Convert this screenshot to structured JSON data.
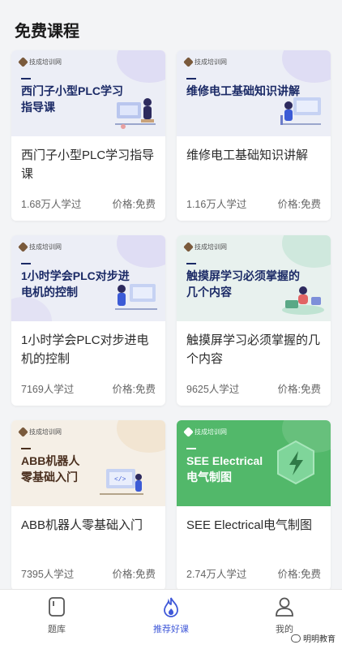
{
  "page": {
    "title": "免费课程"
  },
  "logo_text": "技成培训网",
  "courses": [
    {
      "thumb_title_line1": "西门子小型PLC学习",
      "thumb_title_line2": "指导课",
      "name": "西门子小型PLC学习指导课",
      "learners": "1.68万人学过",
      "price": "价格:免费",
      "theme": "light"
    },
    {
      "thumb_title_line1": "维修电工基础知识讲解",
      "thumb_title_line2": "",
      "name": "维修电工基础知识讲解",
      "learners": "1.16万人学过",
      "price": "价格:免费",
      "theme": "light"
    },
    {
      "thumb_title_line1": "1小时学会PLC对步进",
      "thumb_title_line2": "电机的控制",
      "name": "1小时学会PLC对步进电机的控制",
      "learners": "7169人学过",
      "price": "价格:免费",
      "theme": "light"
    },
    {
      "thumb_title_line1": "触摸屏学习必须掌握的",
      "thumb_title_line2": "几个内容",
      "name": "触摸屏学习必须掌握的几个内容",
      "learners": "9625人学过",
      "price": "价格:免费",
      "theme": "mint"
    },
    {
      "thumb_title_line1": "ABB机器人",
      "thumb_title_line2": "零基础入门",
      "name": "ABB机器人零基础入门",
      "learners": "7395人学过",
      "price": "价格:免费",
      "theme": "warm"
    },
    {
      "thumb_title_line1": "SEE Electrical",
      "thumb_title_line2": "电气制图",
      "name": "SEE Electrical电气制图",
      "learners": "2.74万人学过",
      "price": "价格:免费",
      "theme": "green"
    }
  ],
  "tabbar": {
    "items": [
      {
        "label": "题库",
        "icon": "question-bank-icon",
        "active": false
      },
      {
        "label": "推荐好课",
        "icon": "flame-icon",
        "active": true
      },
      {
        "label": "我的",
        "icon": "profile-icon",
        "active": false
      }
    ]
  },
  "watermark": "明明教育",
  "colors": {
    "accent": "#3f58d8",
    "thumb_title": "#1b2a66",
    "green_thumb": "#52b86a",
    "background": "#f3f4f6"
  }
}
